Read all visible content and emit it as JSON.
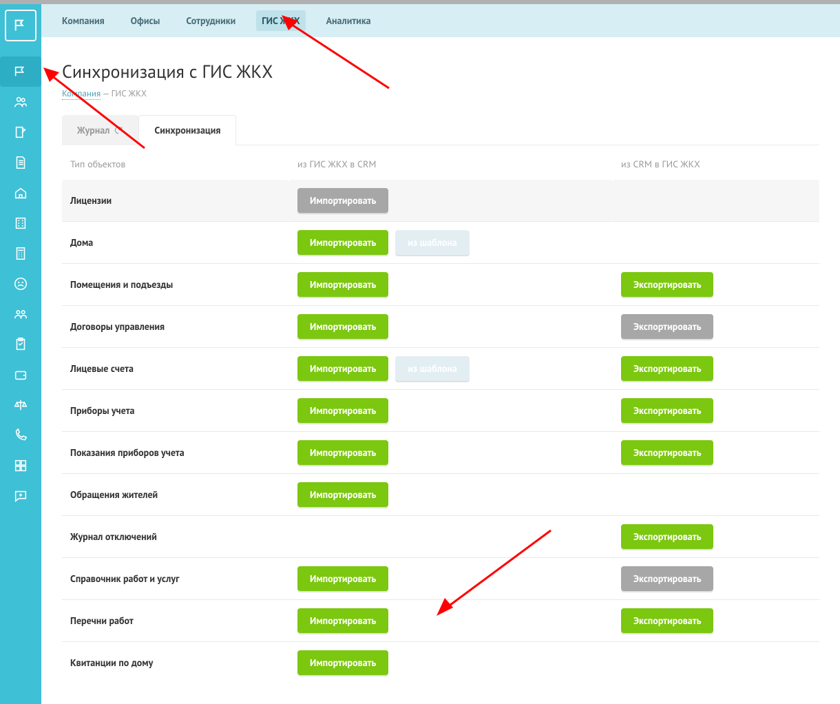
{
  "topnav": {
    "items": [
      {
        "label": "Компания",
        "active": false
      },
      {
        "label": "Офисы",
        "active": false
      },
      {
        "label": "Сотрудники",
        "active": false
      },
      {
        "label": "ГИС ЖКХ",
        "active": true
      },
      {
        "label": "Аналитика",
        "active": false
      }
    ]
  },
  "page": {
    "title": "Синхронизация с ГИС ЖКХ",
    "crumb_link": "Компания",
    "crumb_sep": " — ",
    "crumb_current": "ГИС ЖКХ"
  },
  "tabs": [
    {
      "label": "Журнал",
      "active": false,
      "refresh": true
    },
    {
      "label": "Синхронизация",
      "active": true
    }
  ],
  "labels": {
    "import": "Импортировать",
    "export": "Экспортировать",
    "template": "из шаблона"
  },
  "columns": {
    "c1": "Тип объектов",
    "c2": "из ГИС ЖКХ в CRM",
    "c3": "из CRM в ГИС ЖКХ"
  },
  "rows": [
    {
      "name": "Лицензии",
      "import": "gray",
      "export": null,
      "tmpl": false
    },
    {
      "name": "Дома",
      "import": "green",
      "export": null,
      "tmpl": true
    },
    {
      "name": "Помещения и подъезды",
      "import": "green",
      "export": "green",
      "tmpl": false
    },
    {
      "name": "Договоры управления",
      "import": "green",
      "export": "gray",
      "tmpl": false
    },
    {
      "name": "Лицевые счета",
      "import": "green",
      "export": "green",
      "tmpl": true
    },
    {
      "name": "Приборы учета",
      "import": "green",
      "export": "green",
      "tmpl": false
    },
    {
      "name": "Показания приборов учета",
      "import": "green",
      "export": "green",
      "tmpl": false
    },
    {
      "name": "Обращения жителей",
      "import": "green",
      "export": null,
      "tmpl": false
    },
    {
      "name": "Журнал отключений",
      "import": null,
      "export": "green",
      "tmpl": false
    },
    {
      "name": "Справочник работ и услуг",
      "import": "green",
      "export": "gray",
      "tmpl": false
    },
    {
      "name": "Перечни работ",
      "import": "green",
      "export": "green",
      "tmpl": false
    },
    {
      "name": "Квитанции по дому",
      "import": "green",
      "export": null,
      "tmpl": false
    }
  ],
  "sidebar": [
    "company",
    "users",
    "compose",
    "doc",
    "building-1",
    "building-2",
    "calculator",
    "sad-face",
    "people",
    "clipboard",
    "wallet",
    "scale",
    "phone",
    "dashboard",
    "chat-plus"
  ]
}
